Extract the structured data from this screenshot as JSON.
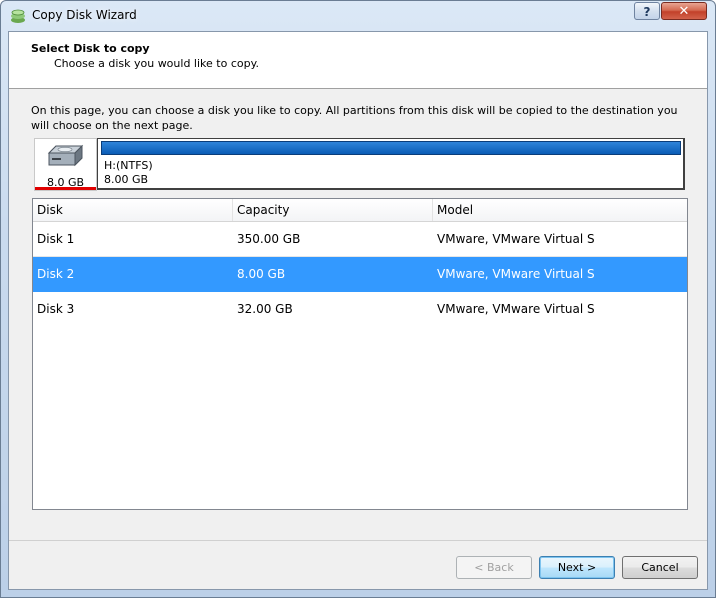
{
  "window": {
    "title": "Copy Disk Wizard",
    "help_label": "?",
    "close_label": "✕"
  },
  "header": {
    "title": "Select Disk to copy",
    "subtitle": "Choose a disk you would like to copy."
  },
  "description": "On this page, you can choose a disk you like to copy. All partitions from this disk will be copied to the destination you will choose on the next page.",
  "disk_map": {
    "disk_size": "8.0 GB",
    "partition": {
      "name": "H:(NTFS)",
      "size": "8.00 GB"
    }
  },
  "disk_list": {
    "columns": [
      "Disk",
      "Capacity",
      "Model"
    ],
    "rows": [
      {
        "disk": "Disk 1",
        "capacity": "350.00 GB",
        "model": "VMware, VMware Virtual S",
        "selected": false
      },
      {
        "disk": "Disk 2",
        "capacity": "8.00 GB",
        "model": "VMware, VMware Virtual S",
        "selected": true
      },
      {
        "disk": "Disk 3",
        "capacity": "32.00 GB",
        "model": "VMware, VMware Virtual S",
        "selected": false
      }
    ]
  },
  "buttons": {
    "back": "< Back",
    "next": "Next >",
    "cancel": "Cancel"
  },
  "colors": {
    "selection": "#3399ff",
    "partition_bar": "#0a5cb5",
    "disk_underline": "#e00000"
  }
}
